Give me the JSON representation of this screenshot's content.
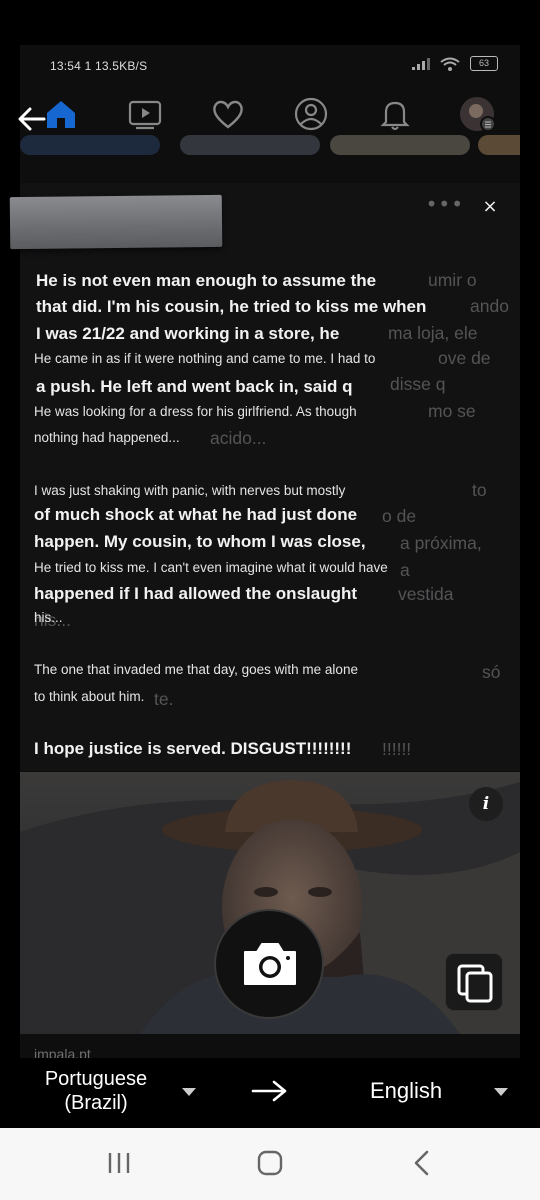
{
  "status_bar": {
    "time": "13:54 1 13.5KB/S",
    "battery": "63"
  },
  "panel": {
    "close_glyph": "×",
    "more_glyph": "•••"
  },
  "ghost_text": [
    "umir o",
    "ando",
    "ma loja, ele",
    "ove de",
    "disse q",
    "mo se",
    "acido...",
    "to",
    "o de",
    "a próxima,",
    "a",
    "vestida",
    "his...",
    "só",
    "te.",
    "!!!!!!"
  ],
  "translation": {
    "p1_l1": "He is not even man enough to assume the",
    "p1_l2": "that did. I'm his cousin, he tried to kiss me when",
    "p1_l3": "I was 21/22 and working in a store, he",
    "p1_l4": "He came in as if it were nothing and came to me. I had to",
    "p1_l5": "a push. He left and went back in, said q",
    "p1_l6": "He was looking for a dress for his girlfriend. As though",
    "p1_l7": "nothing had happened...",
    "p2_l1": "I was just shaking with panic, with nerves but mostly",
    "p2_l2": "of much shock at what he had just done",
    "p2_l3": "happen. My cousin, to whom I was close,",
    "p2_l4": "He tried to kiss me. I can't even imagine what it would have",
    "p2_l5": "happened if I had allowed the onslaught",
    "p2_l6": "his...",
    "p3_l1": "The one that invaded me that day, goes with me alone",
    "p3_l2": "to think about him.",
    "p4_l1": "I hope justice is served. DISGUST!!!!!!!!"
  },
  "image": {
    "info_glyph": "i",
    "source": "impala.pt"
  },
  "languages": {
    "source": "Portuguese (Brazil)",
    "target": "English",
    "swap_glyph": "→"
  },
  "icons": {
    "back": "back-arrow-icon",
    "home": "home-icon",
    "video": "video-icon",
    "dating": "heart-icon",
    "profile": "profile-icon",
    "bell": "bell-icon",
    "camera": "camera-icon",
    "copy": "copy-icon"
  }
}
